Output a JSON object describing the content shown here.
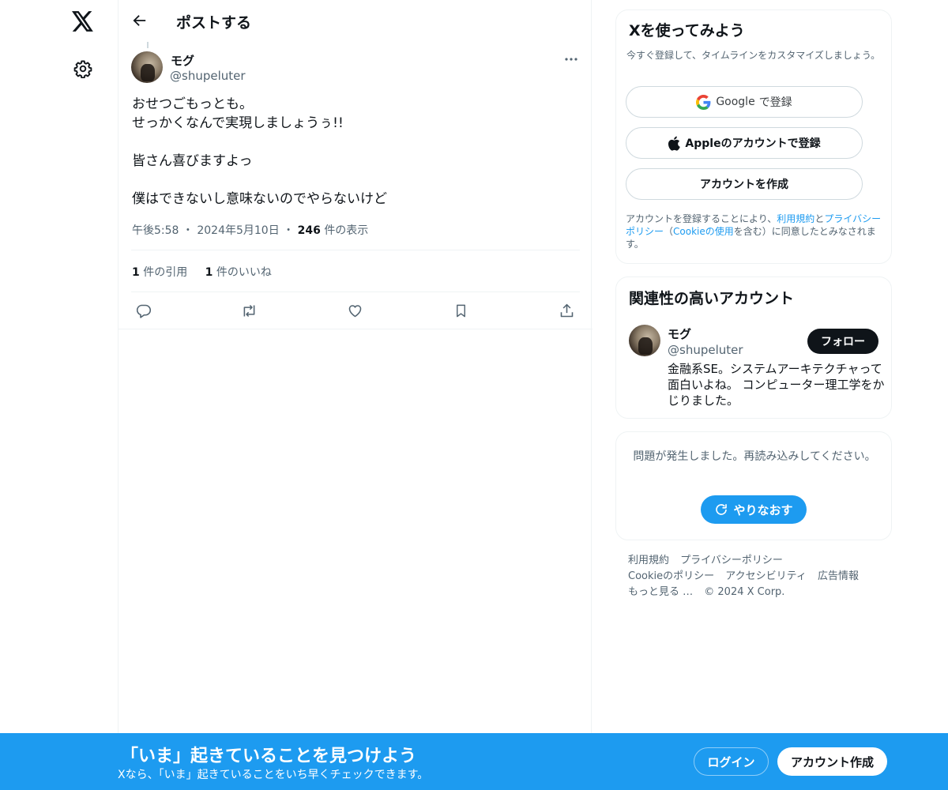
{
  "nav": {
    "logo_icon": "x-logo-icon",
    "settings_icon": "gear-icon"
  },
  "header": {
    "title": "ポストする",
    "back_icon": "arrow-left-icon"
  },
  "post": {
    "author_name": "モグ",
    "author_handle": "@shupeluter",
    "text_lines": [
      "おせつごもっとも。",
      "せっかくなんで実現しましょうぅ!!",
      "",
      "皆さん喜びますよっ",
      "",
      "僕はできないし意味ないのでやらないけど"
    ],
    "time": "午後5:58",
    "date": "2024年5月10日",
    "views_count": "246",
    "views_label": "件の表示",
    "quotes_count": "1",
    "quotes_label": "件の引用",
    "likes_count": "1",
    "likes_label": "件のいいね",
    "separator": "・"
  },
  "signup_card": {
    "title": "Xを使ってみよう",
    "subtitle": "今すぐ登録して、タイムラインをカスタマイズしましょう。",
    "google_button": {
      "brand": "Google",
      "suffix": "で登録"
    },
    "apple_button": "Appleのアカウントで登録",
    "create_button": "アカウントを作成",
    "legal": {
      "prefix": "アカウントを登録することにより、",
      "terms": "利用規約",
      "and": "と",
      "privacy": "プライバシーポリシー",
      "paren_open": "（",
      "cookie": "Cookieの使用",
      "paren_close": "を含む）に同意したとみなされます。"
    }
  },
  "related": {
    "title": "関連性の高いアカウント",
    "name": "モグ",
    "handle": "@shupeluter",
    "follow_label": "フォロー",
    "bio": "金融系SE。システムアーキテクチャって面白いよね。 コンピューター理工学をかじりました。"
  },
  "error_card": {
    "message": "問題が発生しました。再読み込みしてください。",
    "retry_label": "やりなおす"
  },
  "footer": {
    "row1": [
      "利用規約",
      "プライバシーポリシー"
    ],
    "row2": [
      "Cookieのポリシー",
      "アクセシビリティ",
      "広告情報"
    ],
    "row3": [
      "もっと見る …",
      "© 2024 X Corp."
    ]
  },
  "banner": {
    "title": "「いま」起きていることを見つけよう",
    "subtitle": "Xなら、「いま」起きていることをいち早くチェックできます。",
    "login_label": "ログイン",
    "signup_label": "アカウント作成"
  },
  "colors": {
    "accent": "#1d9bf0",
    "text": "#0f1419",
    "muted": "#536471",
    "border": "#eff3f4"
  }
}
